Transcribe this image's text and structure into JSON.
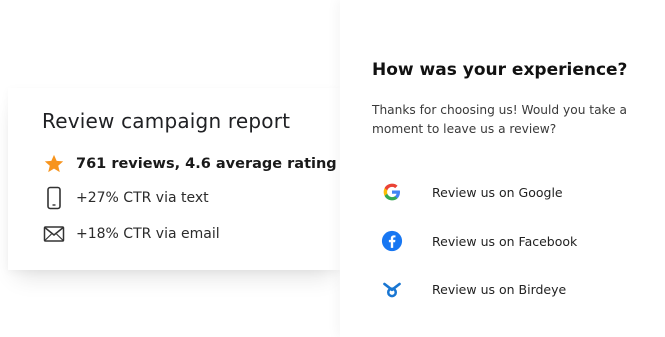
{
  "report": {
    "title": "Review campaign report",
    "stats": [
      {
        "icon": "star-icon",
        "text": "761 reviews, 4.6 average rating"
      },
      {
        "icon": "phone-icon",
        "text": "+27% CTR via text"
      },
      {
        "icon": "envelope-icon",
        "text": "+18% CTR via email"
      }
    ]
  },
  "review_panel": {
    "title": "How was your experience?",
    "subtitle": "Thanks for choosing us! Would you take a moment to leave us a review?",
    "options": [
      {
        "icon": "google-icon",
        "label": "Review us on Google"
      },
      {
        "icon": "facebook-icon",
        "label": "Review us on Facebook"
      },
      {
        "icon": "birdeye-icon",
        "label": "Review us on Birdeye"
      }
    ]
  },
  "colors": {
    "star": "#f7941d",
    "facebook": "#1877f2",
    "birdeye": "#1976d2"
  }
}
